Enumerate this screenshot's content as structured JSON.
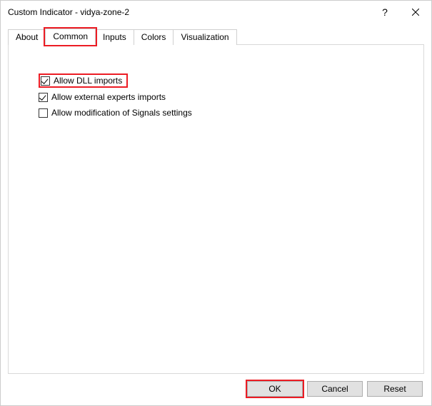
{
  "titlebar": {
    "title": "Custom Indicator - vidya-zone-2",
    "help": "?",
    "close": ""
  },
  "tabs": {
    "about": "About",
    "common": "Common",
    "inputs": "Inputs",
    "colors": "Colors",
    "visualization": "Visualization",
    "active": "common"
  },
  "options": {
    "allow_dll": {
      "label": "Allow DLL imports",
      "checked": true
    },
    "allow_experts": {
      "label": "Allow external experts imports",
      "checked": true
    },
    "allow_signals": {
      "label": "Allow modification of Signals settings",
      "checked": false
    }
  },
  "footer": {
    "ok": "OK",
    "cancel": "Cancel",
    "reset": "Reset"
  },
  "highlights": {
    "common_tab": true,
    "allow_dll_row": true,
    "ok_button": true
  }
}
